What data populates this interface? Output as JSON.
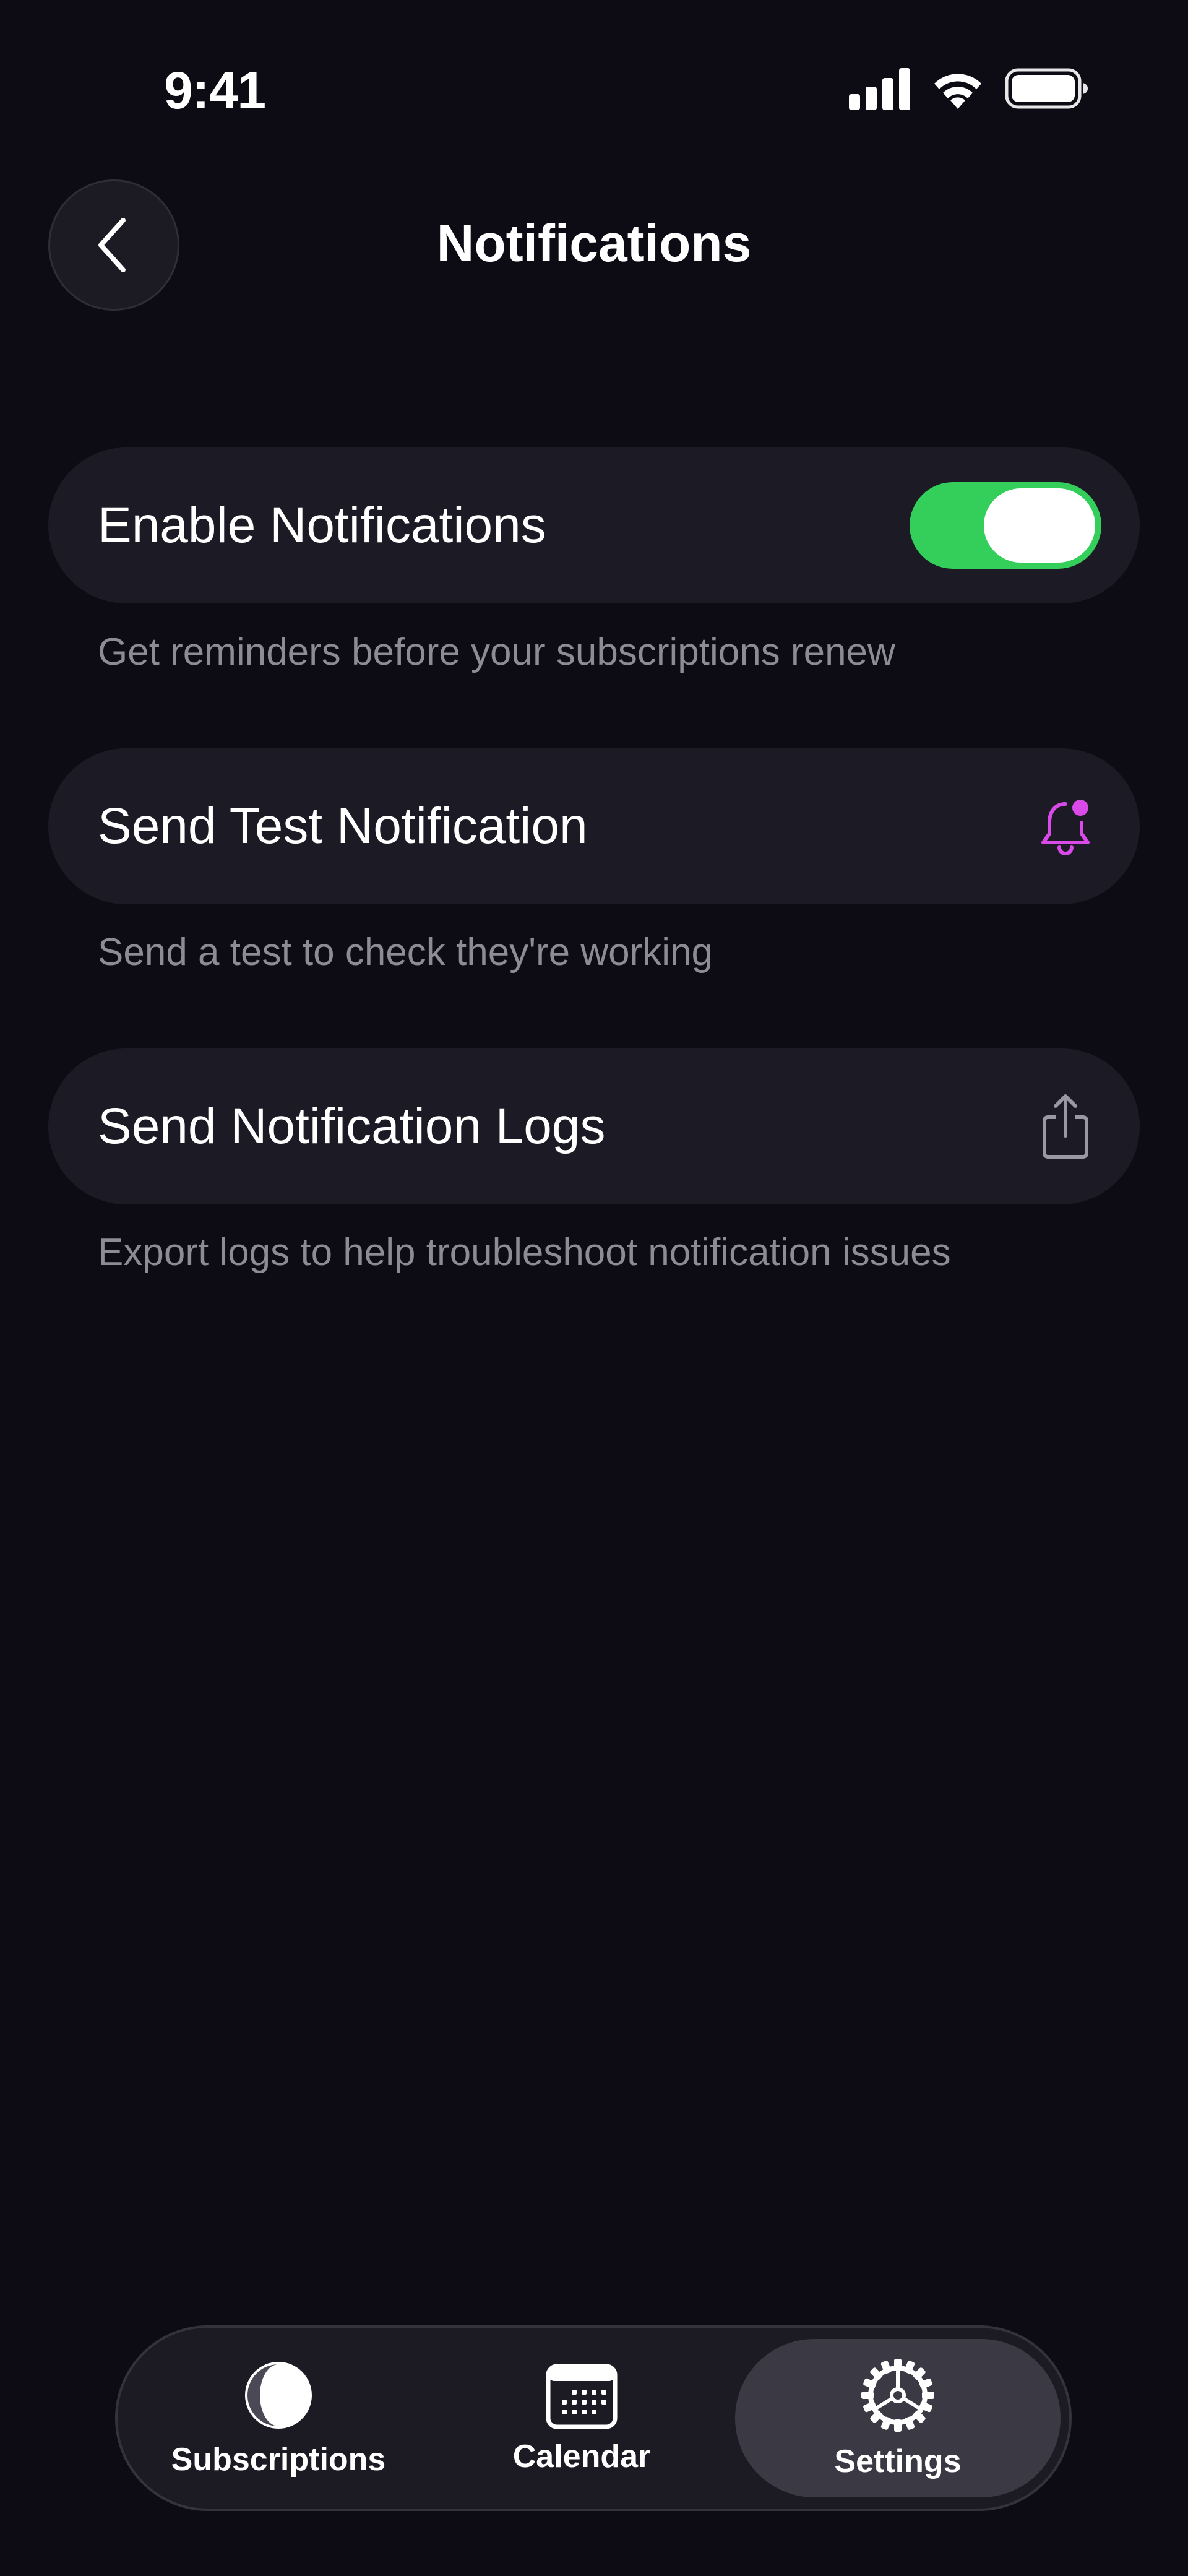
{
  "status_bar": {
    "time": "9:41",
    "signal_icon": "cellular-signal-icon",
    "wifi_icon": "wifi-icon",
    "battery_icon": "battery-icon"
  },
  "header": {
    "title": "Notifications",
    "back_icon": "chevron-left-icon"
  },
  "settings": {
    "enable": {
      "label": "Enable Notifications",
      "caption": "Get reminders before your subscriptions renew",
      "toggle_on": true,
      "toggle_color": "#33cf5a"
    },
    "test": {
      "label": "Send Test Notification",
      "caption": "Send a test to check they're working",
      "icon": "bell-badge-icon",
      "icon_color": "#d94ae8"
    },
    "logs": {
      "label": "Send Notification Logs",
      "caption": "Export logs to help troubleshoot notification issues",
      "icon": "share-icon"
    }
  },
  "tabbar": {
    "tabs": [
      {
        "label": "Subscriptions",
        "icon": "half-circle-icon",
        "selected": false
      },
      {
        "label": "Calendar",
        "icon": "calendar-icon",
        "selected": false
      },
      {
        "label": "Settings",
        "icon": "gear-icon",
        "selected": true
      }
    ]
  }
}
